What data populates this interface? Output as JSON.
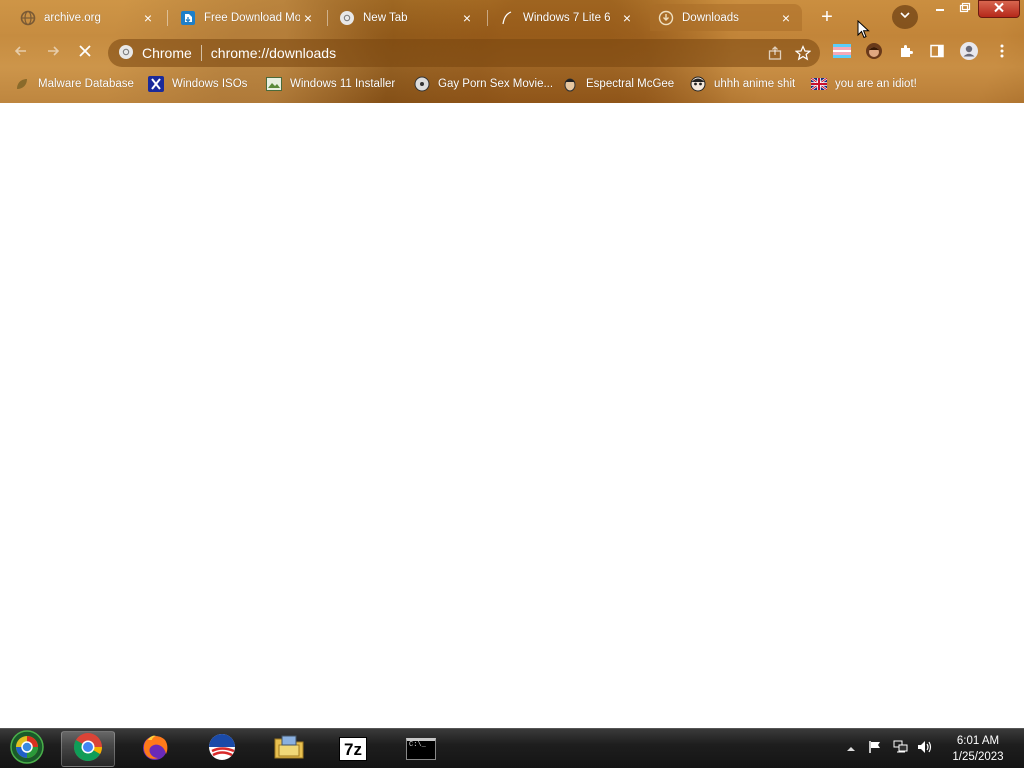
{
  "browser": {
    "tabs": [
      {
        "title": "archive.org",
        "favicon": "globe-icon",
        "active": false
      },
      {
        "title": "Free Download Mo",
        "favicon": "download-site-icon",
        "active": false
      },
      {
        "title": "New Tab",
        "favicon": "chrome-icon",
        "active": false
      },
      {
        "title": "Windows 7 Lite 6",
        "favicon": "feather-icon",
        "active": false
      },
      {
        "title": "Downloads",
        "favicon": "download-icon",
        "active": true
      }
    ],
    "close_glyph": "×",
    "new_tab_glyph": "+",
    "omnibox": {
      "chip_label": "Chrome",
      "url": "chrome://downloads"
    },
    "bookmarks": [
      {
        "label": "Malware Database",
        "icon": "leaf-icon"
      },
      {
        "label": "Windows ISOs",
        "icon": "x-logo-icon"
      },
      {
        "label": "Windows 11 Installer",
        "icon": "image-icon"
      },
      {
        "label": "Gay Porn Sex Movie...",
        "icon": "disc-icon"
      },
      {
        "label": "Espectral McGee",
        "icon": "face-icon"
      },
      {
        "label": "uhhh anime shit",
        "icon": "anime-face-icon"
      },
      {
        "label": "you are an idiot!",
        "icon": "uk-flag-icon"
      }
    ],
    "colors": {
      "frame": "#a86c22",
      "text": "#ffffff"
    }
  },
  "taskbar": {
    "items": [
      {
        "name": "chrome",
        "icon": "chrome-icon",
        "active": true
      },
      {
        "name": "firefox",
        "icon": "firefox-icon",
        "active": false
      },
      {
        "name": "obama",
        "icon": "obama-logo-icon",
        "active": false
      },
      {
        "name": "explorer",
        "icon": "folder-icon",
        "active": false
      },
      {
        "name": "7zip",
        "icon": "7zip-icon",
        "label": "7z",
        "active": false
      },
      {
        "name": "cmd",
        "icon": "terminal-icon",
        "label": "C:\\_",
        "active": false
      }
    ],
    "clock": {
      "time": "6:01 AM",
      "date": "1/25/2023"
    }
  }
}
